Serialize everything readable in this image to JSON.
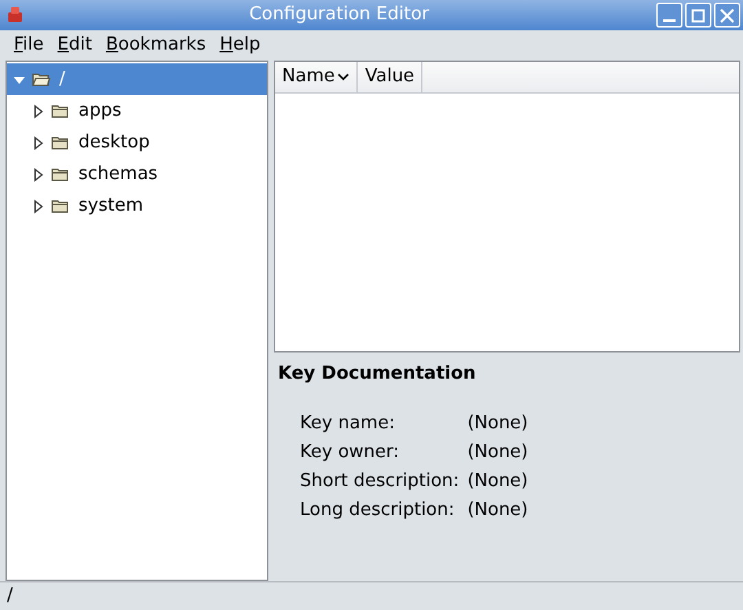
{
  "window": {
    "title": "Configuration Editor"
  },
  "menu": [
    "File",
    "Edit",
    "Bookmarks",
    "Help"
  ],
  "tree": [
    {
      "label": "/",
      "expanded": true,
      "selected": true,
      "children": [
        {
          "label": "apps",
          "expanded": false,
          "selected": false
        },
        {
          "label": "desktop",
          "expanded": false,
          "selected": false
        },
        {
          "label": "schemas",
          "expanded": false,
          "selected": false
        },
        {
          "label": "system",
          "expanded": false,
          "selected": false
        }
      ]
    }
  ],
  "table": {
    "columns": [
      {
        "label": "Name",
        "sorted": true
      },
      {
        "label": "Value",
        "sorted": false
      }
    ]
  },
  "documentation": {
    "title": "Key Documentation",
    "fields": [
      {
        "label": "Key name:",
        "value": "(None)"
      },
      {
        "label": "Key owner:",
        "value": "(None)"
      },
      {
        "label": "Short description:",
        "value": "(None)"
      },
      {
        "label": "Long description:",
        "value": "(None)"
      }
    ]
  },
  "status_bar": "/"
}
